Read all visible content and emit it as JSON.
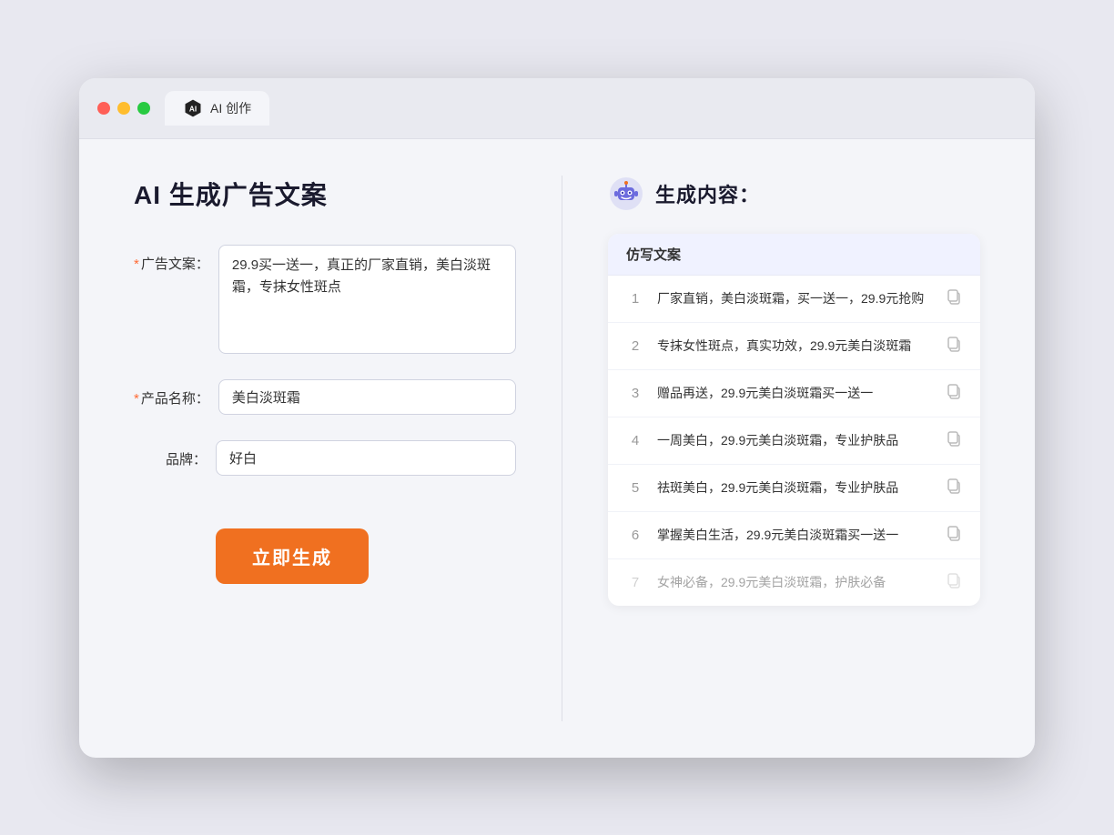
{
  "browser": {
    "tab_label": "AI 创作"
  },
  "page": {
    "title": "AI 生成广告文案",
    "form": {
      "ad_copy_label": "广告文案：",
      "ad_copy_required": "*",
      "ad_copy_value": "29.9买一送一，真正的厂家直销，美白淡斑霜，专抹女性斑点",
      "product_name_label": "产品名称：",
      "product_name_required": "*",
      "product_name_value": "美白淡斑霜",
      "brand_label": "品牌：",
      "brand_value": "好白",
      "generate_button": "立即生成"
    },
    "result": {
      "header": "生成内容：",
      "column_header": "仿写文案",
      "items": [
        {
          "id": 1,
          "text": "厂家直销，美白淡斑霜，买一送一，29.9元抢购",
          "faded": false
        },
        {
          "id": 2,
          "text": "专抹女性斑点，真实功效，29.9元美白淡斑霜",
          "faded": false
        },
        {
          "id": 3,
          "text": "赠品再送，29.9元美白淡斑霜买一送一",
          "faded": false
        },
        {
          "id": 4,
          "text": "一周美白，29.9元美白淡斑霜，专业护肤品",
          "faded": false
        },
        {
          "id": 5,
          "text": "祛斑美白，29.9元美白淡斑霜，专业护肤品",
          "faded": false
        },
        {
          "id": 6,
          "text": "掌握美白生活，29.9元美白淡斑霜买一送一",
          "faded": false
        },
        {
          "id": 7,
          "text": "女神必备，29.9元美白淡斑霜，护肤必备",
          "faded": true
        }
      ]
    }
  }
}
